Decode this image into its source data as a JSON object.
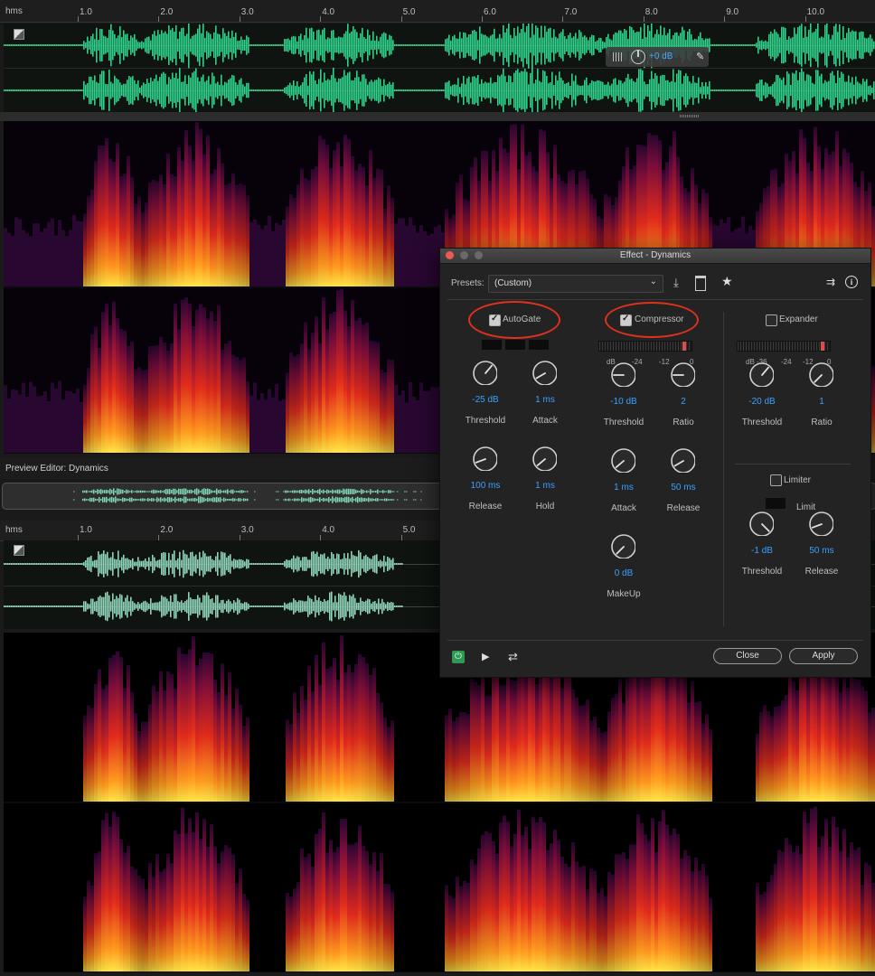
{
  "top_ruler": {
    "unit": "hms",
    "ticks": [
      "1.0",
      "2.0",
      "3.0",
      "4.0",
      "5.0",
      "6.0",
      "7.0",
      "8.0",
      "9.0",
      "10.0"
    ]
  },
  "hud": {
    "gain": "+0 dB"
  },
  "preview_label": "Preview Editor: Dynamics",
  "bottom_ruler": {
    "unit": "hms",
    "ticks": [
      "1.0",
      "2.0",
      "3.0",
      "4.0",
      "5.0"
    ]
  },
  "dialog": {
    "title": "Effect - Dynamics",
    "presets_label": "Presets:",
    "presets_value": "(Custom)",
    "autogate": {
      "label": "AutoGate",
      "checked": true,
      "knobs": [
        {
          "value": "-25 dB",
          "label": "Threshold"
        },
        {
          "value": "1 ms",
          "label": "Attack"
        },
        {
          "value": "100 ms",
          "label": "Release"
        },
        {
          "value": "1 ms",
          "label": "Hold"
        }
      ]
    },
    "compressor": {
      "label": "Compressor",
      "checked": true,
      "meter_ticks": [
        "dB",
        "-24",
        "-12",
        "0"
      ],
      "knobs": [
        {
          "value": "-10 dB",
          "label": "Threshold"
        },
        {
          "value": "2",
          "label": "Ratio"
        },
        {
          "value": "1 ms",
          "label": "Attack"
        },
        {
          "value": "50 ms",
          "label": "Release"
        },
        {
          "value": "0 dB",
          "label": "MakeUp"
        }
      ]
    },
    "expander": {
      "label": "Expander",
      "checked": false,
      "meter_ticks": [
        "dB -36",
        "-24",
        "-12",
        "0"
      ],
      "knobs": [
        {
          "value": "-20 dB",
          "label": "Threshold"
        },
        {
          "value": "1",
          "label": "Ratio"
        }
      ]
    },
    "limiter": {
      "label": "Limiter",
      "checked": false,
      "limit_label": "Limit",
      "knobs": [
        {
          "value": "-1 dB",
          "label": "Threshold"
        },
        {
          "value": "50 ms",
          "label": "Release"
        }
      ]
    },
    "buttons": {
      "close": "Close",
      "apply": "Apply"
    },
    "colors": {
      "accent": "#3aa0ff",
      "annotation": "#e0311e",
      "waveform": "#2fd08a"
    }
  }
}
